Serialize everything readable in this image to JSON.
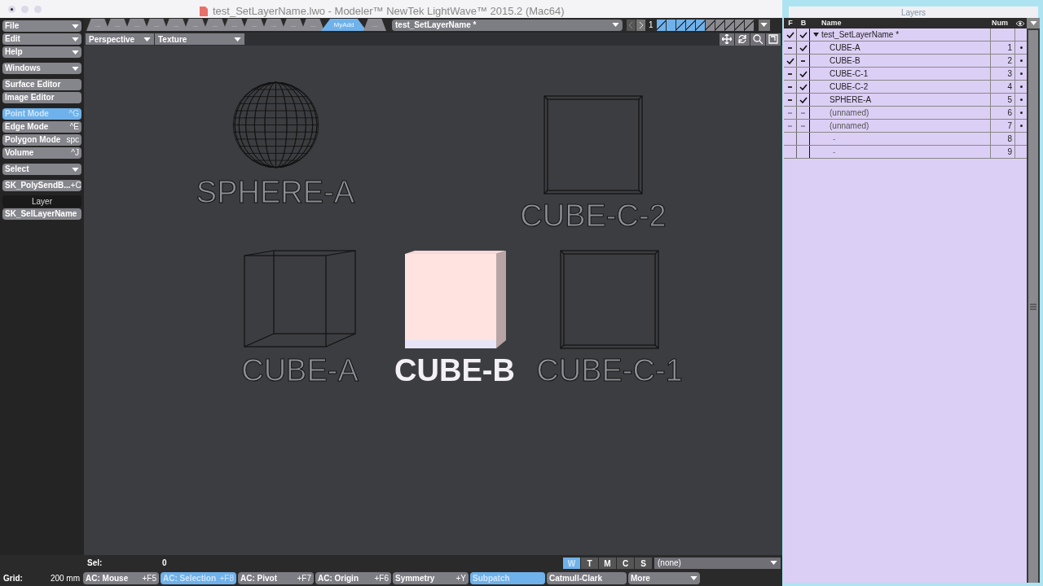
{
  "window": {
    "title": "test_SetLayerName.lwo - Modeler™ NewTek LightWave™ 2015.2 (Mac64)"
  },
  "toolbar": [
    {
      "kind": "menu",
      "label": "File",
      "selected": false
    },
    {
      "kind": "menu",
      "label": "Edit",
      "selected": false
    },
    {
      "kind": "menu",
      "label": "Help",
      "selected": false
    },
    {
      "kind": "gap"
    },
    {
      "kind": "menu",
      "label": "Windows",
      "selected": false
    },
    {
      "kind": "gap"
    },
    {
      "kind": "button",
      "label": "Surface Editor",
      "selected": false
    },
    {
      "kind": "button",
      "label": "Image Editor",
      "selected": false
    },
    {
      "kind": "gap"
    },
    {
      "kind": "button",
      "label": "Point Mode",
      "shortcut": "^G",
      "selected": true
    },
    {
      "kind": "button",
      "label": "Edge Mode",
      "shortcut": "^E",
      "selected": false
    },
    {
      "kind": "button",
      "label": "Polygon Mode",
      "shortcut": "spc",
      "selected": false
    },
    {
      "kind": "button",
      "label": "Volume",
      "shortcut": "^J",
      "selected": false
    },
    {
      "kind": "gap"
    },
    {
      "kind": "menu",
      "label": "Select",
      "selected": false
    },
    {
      "kind": "gap"
    },
    {
      "kind": "button",
      "label": "SK_PolySendB...",
      "shortcut": "+C",
      "selected": false
    },
    {
      "kind": "gap"
    },
    {
      "kind": "header",
      "label": "Layer"
    },
    {
      "kind": "button",
      "label": "SK_SelLayerName",
      "selected": false
    }
  ],
  "tabs": [
    {
      "label": "...",
      "selected": false
    },
    {
      "label": "...",
      "selected": false
    },
    {
      "label": "...",
      "selected": false
    },
    {
      "label": "...",
      "selected": false
    },
    {
      "label": "...",
      "selected": false
    },
    {
      "label": "...",
      "selected": false
    },
    {
      "label": "...",
      "selected": false
    },
    {
      "label": "...",
      "selected": false
    },
    {
      "label": "...",
      "selected": false
    },
    {
      "label": "...",
      "selected": false
    },
    {
      "label": "...",
      "selected": false
    },
    {
      "label": "...",
      "selected": false
    },
    {
      "label": "MyAdd",
      "selected": true
    },
    {
      "label": "...",
      "selected": false
    }
  ],
  "object_menu": {
    "value": "test_SetLayerName *"
  },
  "layer_page": "1",
  "layer_buttons": [
    {
      "foreground": false,
      "has_data": true
    },
    {
      "foreground": true
    },
    {
      "foreground": false,
      "has_data": true
    },
    {
      "foreground": false,
      "has_data": true
    },
    {
      "foreground": false,
      "has_data": true
    },
    {
      "foreground": false,
      "has_data": false
    },
    {
      "foreground": false,
      "has_data": false
    },
    {
      "foreground": false,
      "has_data": false
    },
    {
      "foreground": false,
      "has_data": false
    },
    {
      "foreground": false,
      "has_data": false
    }
  ],
  "viewport": {
    "view": "Perspective",
    "shading": "Texture",
    "objects": [
      {
        "kind": "sphere",
        "label": "SPHERE-A",
        "selected": false
      },
      {
        "kind": "cube-front",
        "label": "CUBE-C-2",
        "selected": false
      },
      {
        "kind": "cube-box",
        "label": "CUBE-A",
        "selected": false
      },
      {
        "kind": "cube-solid",
        "label": "CUBE-B",
        "selected": true
      },
      {
        "kind": "cube-front",
        "label": "CUBE-C-1",
        "selected": false
      }
    ]
  },
  "layers_panel": {
    "title": "Layers",
    "columns": [
      "F",
      "B",
      "Name",
      "Num"
    ],
    "rows": [
      {
        "f": true,
        "b": true,
        "name": "test_SetLayerName *",
        "expanded": true,
        "children": [
          {
            "f": false,
            "b": true,
            "dimmed": false,
            "name": "CUBE-A",
            "num": "1",
            "has_data": true
          },
          {
            "f": true,
            "b": false,
            "dimmed": false,
            "name": "CUBE-B",
            "num": "2",
            "has_data": true
          },
          {
            "f": false,
            "b": true,
            "dimmed": false,
            "name": "CUBE-C-1",
            "num": "3",
            "has_data": true
          },
          {
            "f": false,
            "b": true,
            "dimmed": false,
            "name": "CUBE-C-2",
            "num": "4",
            "has_data": true
          },
          {
            "f": false,
            "b": true,
            "dimmed": false,
            "name": "SPHERE-A",
            "num": "5",
            "has_data": true
          },
          {
            "f": false,
            "b": false,
            "dimmed": true,
            "name": "(unnamed)",
            "num": "6",
            "has_data": true
          },
          {
            "f": false,
            "b": false,
            "dimmed": true,
            "name": "(unnamed)",
            "num": "7",
            "has_data": true
          },
          {
            "dimmed": true,
            "name": "-",
            "num": "8",
            "has_data": false
          },
          {
            "dimmed": true,
            "name": "-",
            "num": "9",
            "has_data": false
          }
        ]
      }
    ]
  },
  "status": {
    "sel_label": "Sel:",
    "sel_value": "0",
    "grid_label": "Grid:",
    "grid_value": "200 mm",
    "views": [
      {
        "label": "W",
        "selected": true
      },
      {
        "label": "T",
        "selected": false
      },
      {
        "label": "M",
        "selected": false
      },
      {
        "label": "C",
        "selected": false
      },
      {
        "label": "S",
        "selected": false
      }
    ],
    "surface": "(none)",
    "buttons": [
      {
        "kind": "button",
        "label": "AC: Mouse",
        "shortcut": "+F5",
        "selected": false
      },
      {
        "kind": "button",
        "label": "AC: Selection",
        "shortcut": "+F8",
        "selected": true
      },
      {
        "kind": "button",
        "label": "AC: Pivot",
        "shortcut": "+F7",
        "selected": false
      },
      {
        "kind": "button",
        "label": "AC: Origin",
        "shortcut": "+F6",
        "selected": false
      },
      {
        "kind": "button",
        "label": "Symmetry",
        "shortcut": "+Y",
        "selected": false
      },
      {
        "kind": "button",
        "label": "Subpatch",
        "selected": true
      },
      {
        "kind": "button",
        "label": "Catmull-Clark",
        "selected": false
      },
      {
        "kind": "menu",
        "label": "More",
        "selected": false
      }
    ]
  }
}
